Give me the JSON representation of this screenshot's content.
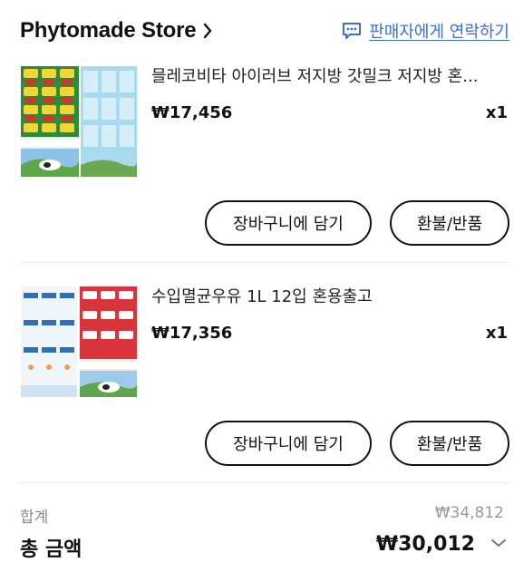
{
  "store": {
    "name": "Phytomade Store",
    "contact_label": "판매자에게 연락하기"
  },
  "items": [
    {
      "title": "믈레코비타 아이러브 저지방 갓밀크 저지방 혼...",
      "price": "₩17,456",
      "quantity": "x1",
      "cart_button": "장바구니에 담기",
      "refund_button": "환불/반품"
    },
    {
      "title": "수입멸균우유 1L 12입 혼용출고",
      "price": "₩17,356",
      "quantity": "x1",
      "cart_button": "장바구니에 담기",
      "refund_button": "환불/반품"
    }
  ],
  "summary": {
    "subtotal_label": "합계",
    "subtotal_value": "₩34,812",
    "total_label": "총 금액",
    "total_value": "₩30,012"
  },
  "colors": {
    "link": "#3a6fd8",
    "text": "#111111",
    "muted": "#8a8a8a"
  }
}
